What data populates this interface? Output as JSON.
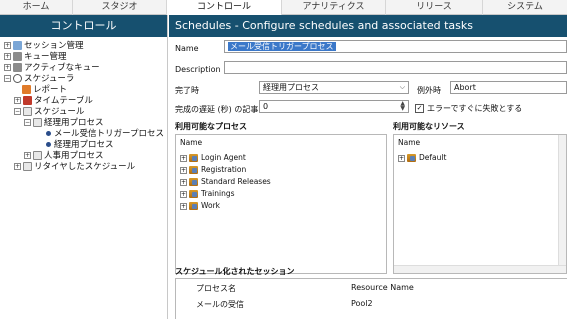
{
  "tabs": [
    "ホーム",
    "スタジオ",
    "コントロール",
    "アナリティクス",
    "リリース",
    "システム"
  ],
  "left": {
    "title": "コントロール",
    "tree": [
      {
        "label": "セッション管理",
        "expander": "+"
      },
      {
        "label": "キュー管理",
        "expander": "+"
      },
      {
        "label": "アクティブなキュー",
        "expander": "+"
      },
      {
        "label": "スケジューラ",
        "expander": "−"
      },
      {
        "label": "レポート",
        "expander": ""
      },
      {
        "label": "タイムテーブル",
        "expander": "+"
      },
      {
        "label": "スケジュール",
        "expander": "−"
      },
      {
        "label": "経理用プロセス",
        "expander": "−"
      },
      {
        "label": "メール受信トリガープロセス",
        "expander": ""
      },
      {
        "label": "経理用プロセス",
        "expander": ""
      },
      {
        "label": "人事用プロセス",
        "expander": "+"
      },
      {
        "label": "リタイヤしたスケジュール",
        "expander": "+"
      }
    ]
  },
  "right": {
    "title": "Schedules - Configure schedules and associated tasks",
    "name_label": "Name",
    "name_value": "メール受信トリガープロセス",
    "description_label": "Description",
    "description_value": "",
    "completion_label": "完了時",
    "completion_value": "経理用プロセス",
    "exception_label": "例外時",
    "exception_value": "Abort",
    "delay_label": "完成の遅延 (秒) の記事",
    "delay_value": "0",
    "fail_fast_label": "エラーですぐに失敗とする",
    "fail_fast_checked": "✓",
    "processes": {
      "title": "利用可能なプロセス",
      "column": "Name",
      "items": [
        "Login Agent",
        "Registration",
        "Standard Releases",
        "Trainings",
        "Work"
      ]
    },
    "resources": {
      "title": "利用可能なリソース",
      "column": "Name",
      "items": [
        "Default"
      ]
    },
    "sessions": {
      "title": "スケジュール化されたセッション",
      "col1": "プロセス名",
      "col2": "Resource Name",
      "rows": [
        {
          "process": "メールの受信",
          "resource": "Pool2"
        }
      ]
    }
  },
  "colors": {
    "header_bg": "#16506f",
    "selection": "#3b78c9"
  }
}
